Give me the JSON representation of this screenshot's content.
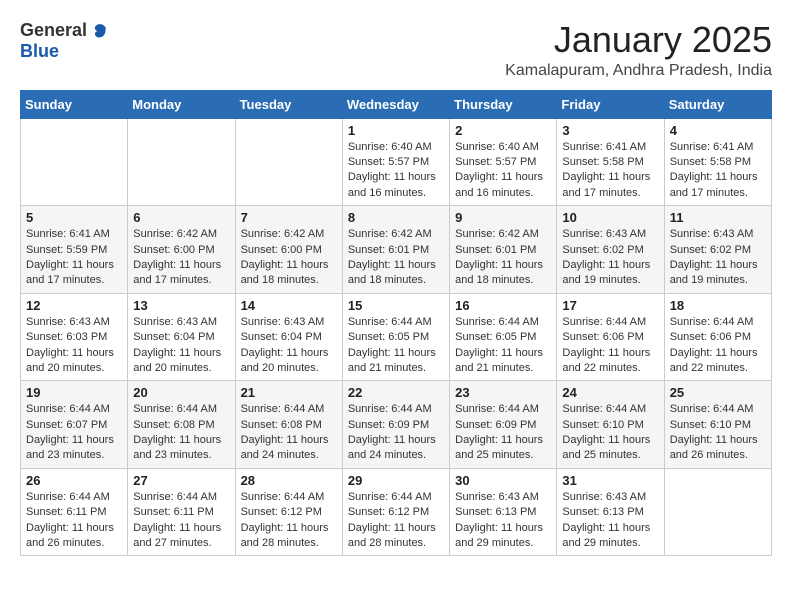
{
  "header": {
    "logo_general": "General",
    "logo_blue": "Blue",
    "month_title": "January 2025",
    "location": "Kamalapuram, Andhra Pradesh, India"
  },
  "weekdays": [
    "Sunday",
    "Monday",
    "Tuesday",
    "Wednesday",
    "Thursday",
    "Friday",
    "Saturday"
  ],
  "weeks": [
    [
      {
        "day": "",
        "info": ""
      },
      {
        "day": "",
        "info": ""
      },
      {
        "day": "",
        "info": ""
      },
      {
        "day": "1",
        "info": "Sunrise: 6:40 AM\nSunset: 5:57 PM\nDaylight: 11 hours\nand 16 minutes."
      },
      {
        "day": "2",
        "info": "Sunrise: 6:40 AM\nSunset: 5:57 PM\nDaylight: 11 hours\nand 16 minutes."
      },
      {
        "day": "3",
        "info": "Sunrise: 6:41 AM\nSunset: 5:58 PM\nDaylight: 11 hours\nand 17 minutes."
      },
      {
        "day": "4",
        "info": "Sunrise: 6:41 AM\nSunset: 5:58 PM\nDaylight: 11 hours\nand 17 minutes."
      }
    ],
    [
      {
        "day": "5",
        "info": "Sunrise: 6:41 AM\nSunset: 5:59 PM\nDaylight: 11 hours\nand 17 minutes."
      },
      {
        "day": "6",
        "info": "Sunrise: 6:42 AM\nSunset: 6:00 PM\nDaylight: 11 hours\nand 17 minutes."
      },
      {
        "day": "7",
        "info": "Sunrise: 6:42 AM\nSunset: 6:00 PM\nDaylight: 11 hours\nand 18 minutes."
      },
      {
        "day": "8",
        "info": "Sunrise: 6:42 AM\nSunset: 6:01 PM\nDaylight: 11 hours\nand 18 minutes."
      },
      {
        "day": "9",
        "info": "Sunrise: 6:42 AM\nSunset: 6:01 PM\nDaylight: 11 hours\nand 18 minutes."
      },
      {
        "day": "10",
        "info": "Sunrise: 6:43 AM\nSunset: 6:02 PM\nDaylight: 11 hours\nand 19 minutes."
      },
      {
        "day": "11",
        "info": "Sunrise: 6:43 AM\nSunset: 6:02 PM\nDaylight: 11 hours\nand 19 minutes."
      }
    ],
    [
      {
        "day": "12",
        "info": "Sunrise: 6:43 AM\nSunset: 6:03 PM\nDaylight: 11 hours\nand 20 minutes."
      },
      {
        "day": "13",
        "info": "Sunrise: 6:43 AM\nSunset: 6:04 PM\nDaylight: 11 hours\nand 20 minutes."
      },
      {
        "day": "14",
        "info": "Sunrise: 6:43 AM\nSunset: 6:04 PM\nDaylight: 11 hours\nand 20 minutes."
      },
      {
        "day": "15",
        "info": "Sunrise: 6:44 AM\nSunset: 6:05 PM\nDaylight: 11 hours\nand 21 minutes."
      },
      {
        "day": "16",
        "info": "Sunrise: 6:44 AM\nSunset: 6:05 PM\nDaylight: 11 hours\nand 21 minutes."
      },
      {
        "day": "17",
        "info": "Sunrise: 6:44 AM\nSunset: 6:06 PM\nDaylight: 11 hours\nand 22 minutes."
      },
      {
        "day": "18",
        "info": "Sunrise: 6:44 AM\nSunset: 6:06 PM\nDaylight: 11 hours\nand 22 minutes."
      }
    ],
    [
      {
        "day": "19",
        "info": "Sunrise: 6:44 AM\nSunset: 6:07 PM\nDaylight: 11 hours\nand 23 minutes."
      },
      {
        "day": "20",
        "info": "Sunrise: 6:44 AM\nSunset: 6:08 PM\nDaylight: 11 hours\nand 23 minutes."
      },
      {
        "day": "21",
        "info": "Sunrise: 6:44 AM\nSunset: 6:08 PM\nDaylight: 11 hours\nand 24 minutes."
      },
      {
        "day": "22",
        "info": "Sunrise: 6:44 AM\nSunset: 6:09 PM\nDaylight: 11 hours\nand 24 minutes."
      },
      {
        "day": "23",
        "info": "Sunrise: 6:44 AM\nSunset: 6:09 PM\nDaylight: 11 hours\nand 25 minutes."
      },
      {
        "day": "24",
        "info": "Sunrise: 6:44 AM\nSunset: 6:10 PM\nDaylight: 11 hours\nand 25 minutes."
      },
      {
        "day": "25",
        "info": "Sunrise: 6:44 AM\nSunset: 6:10 PM\nDaylight: 11 hours\nand 26 minutes."
      }
    ],
    [
      {
        "day": "26",
        "info": "Sunrise: 6:44 AM\nSunset: 6:11 PM\nDaylight: 11 hours\nand 26 minutes."
      },
      {
        "day": "27",
        "info": "Sunrise: 6:44 AM\nSunset: 6:11 PM\nDaylight: 11 hours\nand 27 minutes."
      },
      {
        "day": "28",
        "info": "Sunrise: 6:44 AM\nSunset: 6:12 PM\nDaylight: 11 hours\nand 28 minutes."
      },
      {
        "day": "29",
        "info": "Sunrise: 6:44 AM\nSunset: 6:12 PM\nDaylight: 11 hours\nand 28 minutes."
      },
      {
        "day": "30",
        "info": "Sunrise: 6:43 AM\nSunset: 6:13 PM\nDaylight: 11 hours\nand 29 minutes."
      },
      {
        "day": "31",
        "info": "Sunrise: 6:43 AM\nSunset: 6:13 PM\nDaylight: 11 hours\nand 29 minutes."
      },
      {
        "day": "",
        "info": ""
      }
    ]
  ]
}
